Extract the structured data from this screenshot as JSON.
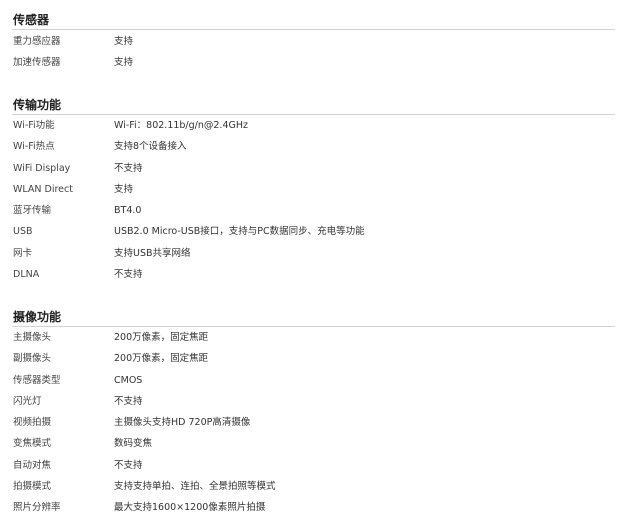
{
  "sections": [
    {
      "title": "传感器",
      "rows": [
        {
          "label": "重力感应器",
          "value": "支持"
        },
        {
          "label": "加速传感器",
          "value": "支持"
        }
      ]
    },
    {
      "title": "传输功能",
      "rows": [
        {
          "label": "Wi-Fi功能",
          "value": "Wi-Fi：802.11b/g/n@2.4GHz"
        },
        {
          "label": "Wi-Fi热点",
          "value": "支持8个设备接入"
        },
        {
          "label": "WiFi Display",
          "value": "不支持"
        },
        {
          "label": "WLAN Direct",
          "value": "支持"
        },
        {
          "label": "蓝牙传输",
          "value": "BT4.0"
        },
        {
          "label": "USB",
          "value": "USB2.0 Micro-USB接口，支持与PC数据同步、充电等功能"
        },
        {
          "label": "网卡",
          "value": "支持USB共享网络"
        },
        {
          "label": "DLNA",
          "value": "不支持"
        }
      ]
    },
    {
      "title": "摄像功能",
      "rows": [
        {
          "label": "主摄像头",
          "value": "200万像素，固定焦距"
        },
        {
          "label": "副摄像头",
          "value": "200万像素，固定焦距"
        },
        {
          "label": "传感器类型",
          "value": "CMOS"
        },
        {
          "label": "闪光灯",
          "value": "不支持"
        },
        {
          "label": "视频拍摄",
          "value": "主摄像头支持HD 720P高清摄像"
        },
        {
          "label": "变焦模式",
          "value": "数码变焦"
        },
        {
          "label": "自动对焦",
          "value": "不支持"
        },
        {
          "label": "拍摄模式",
          "value": "支持支持单拍、连拍、全景拍照等模式"
        },
        {
          "label": "照片分辨率",
          "value": "最大支持1600×1200像素照片拍摄"
        }
      ]
    }
  ]
}
